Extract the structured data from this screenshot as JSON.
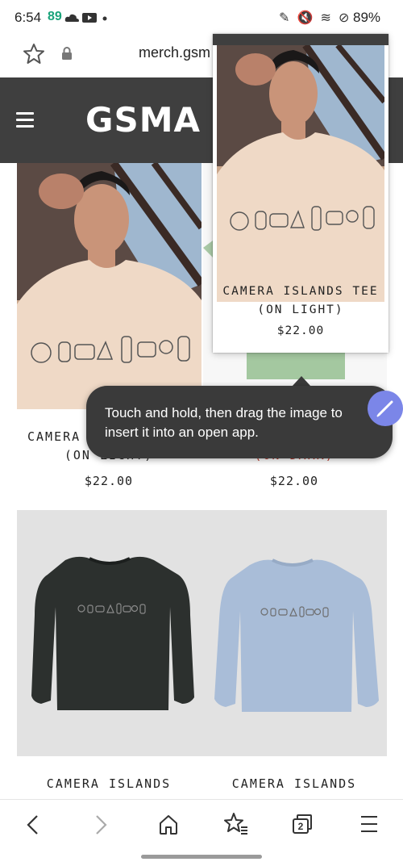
{
  "status_bar": {
    "time": "6:54",
    "notification_count": "89",
    "right_icons": "✎ 🔇 ≋ ⊘",
    "battery": "89%"
  },
  "browser": {
    "url": "merch.gsm",
    "tab_count": "2"
  },
  "site": {
    "logo": "GSMA"
  },
  "preview": {
    "title_line1": "CAMERA ISLANDS TEE",
    "title_line2": "(ON LIGHT)",
    "price": "$22.00"
  },
  "tooltip": {
    "text": "Touch and hold, then drag the image to insert it into an open app."
  },
  "products": [
    {
      "title_line1": "CAMERA",
      "title_line2": "(ON LIGHT)",
      "price": "$22.00"
    },
    {
      "title_line1": "",
      "title_line2": "(ON DARK)",
      "price": "$22.00"
    },
    {
      "title_line1": "CAMERA ISLANDS",
      "price": ""
    },
    {
      "title_line1": "CAMERA ISLANDS",
      "price": ""
    }
  ]
}
